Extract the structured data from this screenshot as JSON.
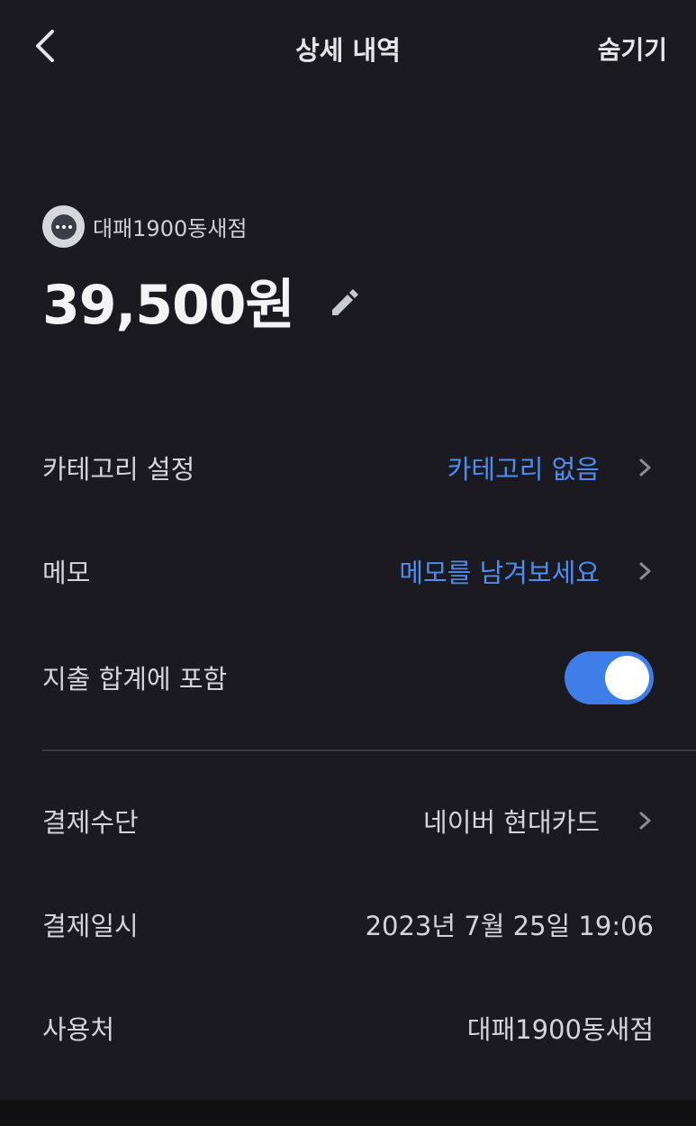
{
  "header": {
    "title": "상세 내역",
    "hide_label": "숨기기"
  },
  "merchant": {
    "name": "대패1900동새점",
    "amount": "39,500원"
  },
  "settings": {
    "category": {
      "label": "카테고리 설정",
      "value": "카테고리 없음"
    },
    "memo": {
      "label": "메모",
      "value": "메모를 남겨보세요"
    },
    "include_total": {
      "label": "지출 합계에 포함",
      "enabled": true
    }
  },
  "details": {
    "payment_method": {
      "label": "결제수단",
      "value": "네이버 현대카드"
    },
    "payment_date": {
      "label": "결제일시",
      "value": "2023년 7월 25일 19:06"
    },
    "place": {
      "label": "사용처",
      "value": "대패1900동새점"
    }
  },
  "colors": {
    "background": "#1a1a20",
    "accent": "#4f8ef0",
    "toggle_on": "#3f7ee8"
  },
  "icons": [
    "back-icon",
    "more-dots-icon",
    "pencil-icon",
    "chevron-right-icon"
  ]
}
